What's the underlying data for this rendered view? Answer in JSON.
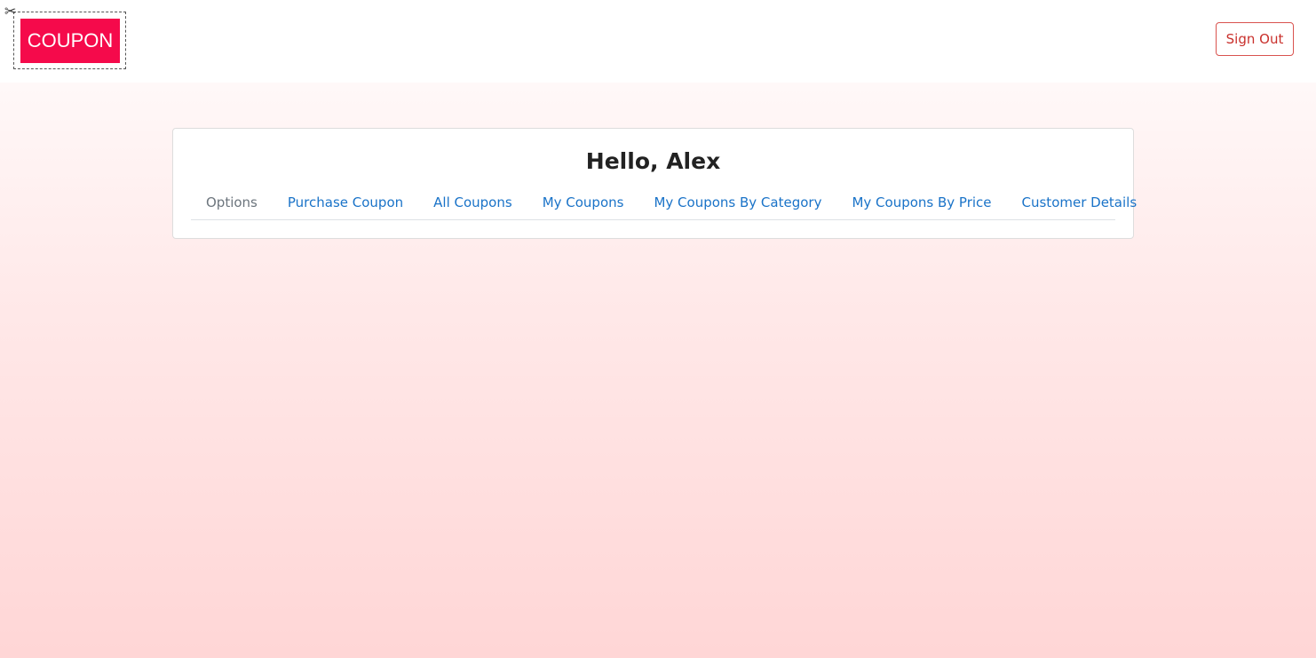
{
  "header": {
    "logo_text": "COUPON",
    "logo_icon": "scissors-icon",
    "sign_out_label": "Sign Out"
  },
  "card": {
    "greeting": "Hello, Alex",
    "nav": [
      {
        "label": "Options",
        "active": false
      },
      {
        "label": "Purchase Coupon"
      },
      {
        "label": "All Coupons"
      },
      {
        "label": "My Coupons"
      },
      {
        "label": "My Coupons By Category"
      },
      {
        "label": "My Coupons By Price"
      },
      {
        "label": "Customer Details"
      }
    ]
  },
  "colors": {
    "brand": "#f50a4b",
    "link": "#1a73c8",
    "danger": "#d9534f"
  }
}
